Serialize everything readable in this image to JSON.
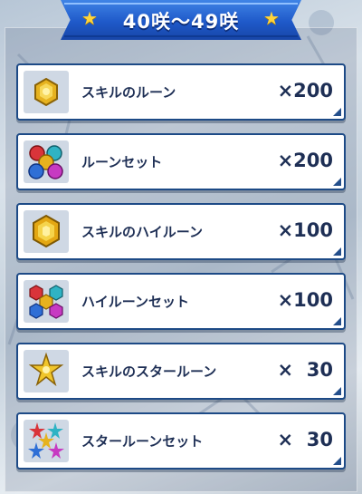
{
  "header": {
    "title": "40咲〜49咲"
  },
  "rewards": [
    {
      "name": "スキルのルーン",
      "qty": "×200",
      "icon": "skill-rune-icon"
    },
    {
      "name": "ルーンセット",
      "qty": "×200",
      "icon": "rune-set-icon"
    },
    {
      "name": "スキルのハイルーン",
      "qty": "×100",
      "icon": "skill-high-rune-icon"
    },
    {
      "name": "ハイルーンセット",
      "qty": "×100",
      "icon": "high-rune-set-icon"
    },
    {
      "name": "スキルのスタールーン",
      "qty": "×  30",
      "icon": "skill-star-rune-icon"
    },
    {
      "name": "スタールーンセット",
      "qty": "×  30",
      "icon": "star-rune-set-icon"
    }
  ],
  "colors": {
    "banner": "#1f59c9",
    "row_border": "#1d4a86",
    "text": "#1e2f55",
    "star": "#ffd43a"
  }
}
